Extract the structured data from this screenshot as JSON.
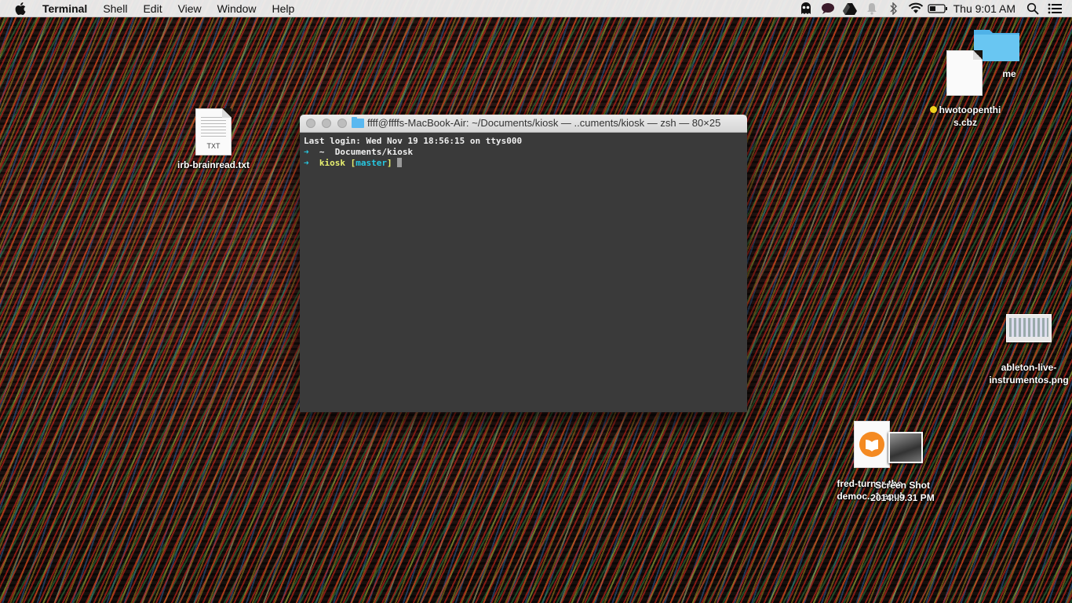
{
  "menubar": {
    "app_name": "Terminal",
    "menus": [
      "Shell",
      "Edit",
      "View",
      "Window",
      "Help"
    ],
    "status_icons": [
      "ghost-icon",
      "chat-icon",
      "drive-icon",
      "notification-bell-icon",
      "bluetooth-icon",
      "wifi-icon",
      "battery-icon"
    ],
    "clock": "Thu 9:01 AM"
  },
  "desktop": {
    "icons": {
      "txt": {
        "label": "irb-brainread.txt",
        "ext": "TXT"
      },
      "folder_me": {
        "label": "me"
      },
      "cbz": {
        "label_line1": "hwotoopenthi",
        "label_line2": "s.cbz",
        "tag_color": "#f0d21c"
      },
      "png": {
        "label_line1": "ableton-live-",
        "label_line2": "instrumentos.png"
      },
      "epub": {
        "label_line1": "fred-turner-the-",
        "label_line2": "democ...1.epub"
      },
      "screenshot": {
        "label_line1": "Screen Shot",
        "label_line2": "2014...9.31 PM"
      }
    }
  },
  "terminal": {
    "title": "ffff@ffffs-MacBook-Air: ~/Documents/kiosk — ..cuments/kiosk — zsh — 80×25",
    "lines": {
      "login": "Last login: Wed Nov 19 18:56:15 on ttys000",
      "l2_arrow": "➜",
      "l2_tilde": "~",
      "l2_path": "Documents/kiosk",
      "l3_arrow": "➜",
      "l3_dir": "kiosk",
      "l3_git_open": "[",
      "l3_branch": "master",
      "l3_git_close": "]"
    }
  },
  "colors": {
    "prompt_arrow": "#27c7e0",
    "dir": "#e8f070",
    "branch": "#27c7e0",
    "folder": "#5ab8f0"
  }
}
